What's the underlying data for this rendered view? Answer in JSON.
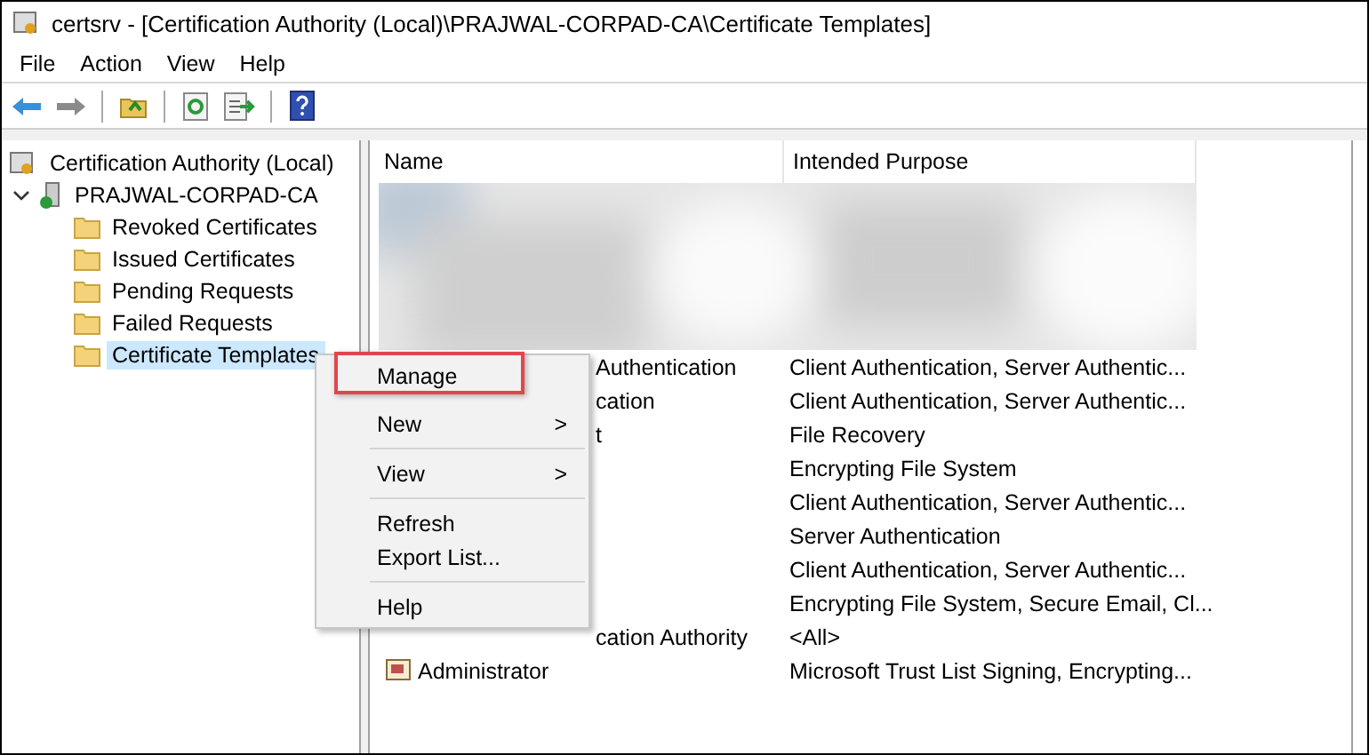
{
  "window": {
    "title": "certsrv - [Certification Authority (Local)\\PRAJWAL-CORPAD-CA\\Certificate Templates]"
  },
  "menu_bar": [
    "File",
    "Action",
    "View",
    "Help"
  ],
  "tree": {
    "label": "Certification Authority (Local)",
    "children": [
      {
        "label": "PRAJWAL-CORPAD-CA",
        "expanded": true,
        "selected": false,
        "children": [
          {
            "label": "Revoked Certificates",
            "selected": false
          },
          {
            "label": "Issued Certificates",
            "selected": false
          },
          {
            "label": "Pending Requests",
            "selected": false
          },
          {
            "label": "Failed Requests",
            "selected": false
          },
          {
            "label": "Certificate Templates",
            "selected": true
          }
        ]
      }
    ]
  },
  "table": {
    "columns": [
      "Name",
      "Intended Purpose"
    ],
    "rows": [
      {
        "kind": "partial",
        "name": "Authentication",
        "purpose": "Client Authentication, Server Authentic..."
      },
      {
        "kind": "partial",
        "name": "cation",
        "purpose": "Client Authentication, Server Authentic..."
      },
      {
        "kind": "partial",
        "name": "t",
        "purpose": "File Recovery"
      },
      {
        "kind": "partial",
        "purpose": "Encrypting File System"
      },
      {
        "kind": "partial",
        "purpose": "Client Authentication, Server Authentic..."
      },
      {
        "kind": "partial",
        "purpose": "Server Authentication"
      },
      {
        "kind": "partial",
        "purpose": "Client Authentication, Server Authentic..."
      },
      {
        "kind": "partial",
        "purpose": "Encrypting File System, Secure Email, Cl..."
      },
      {
        "kind": "partial",
        "name": "cation Authority",
        "purpose": "<All>"
      },
      {
        "kind": "full",
        "name": "Administrator",
        "purpose": "Microsoft Trust List Signing, Encrypting..."
      }
    ]
  },
  "context_menu": [
    {
      "kind": "item",
      "label": "Manage",
      "highlighted": true
    },
    {
      "kind": "submenu",
      "label": "New",
      "arrow": ">"
    },
    {
      "kind": "separator"
    },
    {
      "kind": "submenu",
      "label": "View",
      "arrow": ">"
    },
    {
      "kind": "separator"
    },
    {
      "kind": "item",
      "label": "Refresh",
      "highlighted": false
    },
    {
      "kind": "item",
      "label": "Export List...",
      "highlighted": false
    },
    {
      "kind": "separator"
    },
    {
      "kind": "item",
      "label": "Help",
      "highlighted": false
    }
  ]
}
